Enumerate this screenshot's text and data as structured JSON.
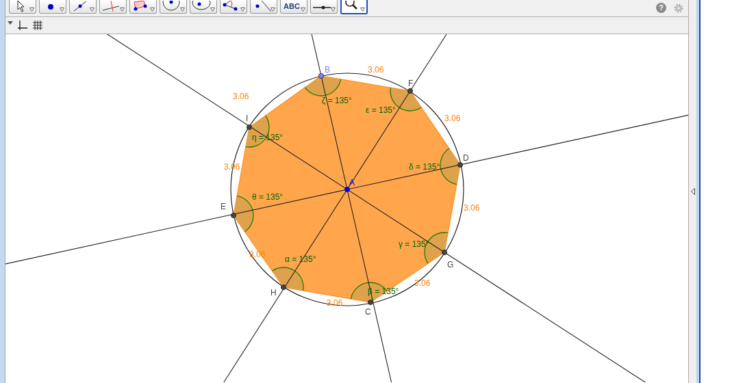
{
  "toolbar": {
    "tools": [
      {
        "kind": "move",
        "selected": false
      },
      {
        "kind": "point",
        "selected": false
      },
      {
        "kind": "line",
        "selected": false
      },
      {
        "kind": "perpendicular",
        "selected": false
      },
      {
        "kind": "polygon",
        "selected": false
      },
      {
        "kind": "circle",
        "selected": false
      },
      {
        "kind": "conic",
        "selected": false
      },
      {
        "kind": "angle",
        "selected": false
      },
      {
        "kind": "reflect",
        "selected": false
      },
      {
        "kind": "text",
        "label": "ABC",
        "selected": false
      },
      {
        "kind": "slider",
        "selected": false
      },
      {
        "kind": "zoom",
        "selected": true
      }
    ],
    "help": "?"
  },
  "drawing": {
    "points": [
      {
        "label": "A",
        "color": "#0000ff"
      },
      {
        "label": "B",
        "color": "#7f7fff"
      },
      {
        "label": "F",
        "color": "#444444"
      },
      {
        "label": "D",
        "color": "#444444"
      },
      {
        "label": "G",
        "color": "#444444"
      },
      {
        "label": "C",
        "color": "#444444"
      },
      {
        "label": "H",
        "color": "#444444"
      },
      {
        "label": "E",
        "color": "#444444"
      },
      {
        "label": "I",
        "color": "#444444"
      }
    ],
    "side_lengths": [
      "3.06",
      "3.06",
      "3.06",
      "3.06",
      "3.06",
      "3.06",
      "3.06",
      "3.06"
    ],
    "angles": [
      "ζ = 135°",
      "ε = 135°",
      "δ = 135°",
      "γ = 135°",
      "β = 135°",
      "α = 135°",
      "θ = 135°",
      "η = 135°"
    ]
  }
}
